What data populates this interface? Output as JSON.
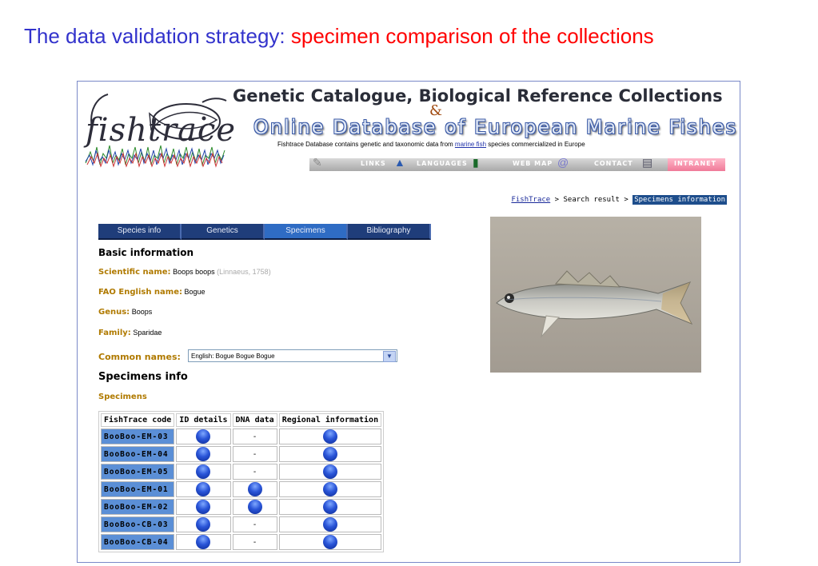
{
  "slide": {
    "title_part1": "The data validation strategy: ",
    "title_part2": "specimen comparison of the collections"
  },
  "header": {
    "logo_text": "fishtrace",
    "line1": "Genetic Catalogue, Biological Reference Collections",
    "ampersand": "&",
    "line2": "Online Database of European Marine Fishes",
    "desc_before": "Fishtrace Database contains genetic and taxonomic data from ",
    "desc_link": "marine fish",
    "desc_after": " species commercialized in Europe"
  },
  "nav": {
    "links": "LINKS",
    "languages": "LANGUAGES",
    "webmap": "WEB MAP",
    "contact": "CONTACT",
    "intranet": "INTRANET"
  },
  "breadcrumb": {
    "home": "FishTrace",
    "sep": " > ",
    "search": "Search result",
    "current": "Specimens information"
  },
  "tabs": [
    "Species info",
    "Genetics",
    "Specimens",
    "Bibliography"
  ],
  "basic": {
    "heading": "Basic information",
    "sci_label": "Scientific name:",
    "sci_value": "Boops boops",
    "sci_author": "(Linnaeus, 1758)",
    "fao_label": "FAO English name:",
    "fao_value": "Bogue",
    "genus_label": "Genus:",
    "genus_value": "Boops",
    "family_label": "Family:",
    "family_value": "Sparidae",
    "common_label": "Common names:",
    "common_value": "English:   Bogue  Bogue  Bogue"
  },
  "specimens": {
    "heading": "Specimens info",
    "subheading": "Specimens",
    "columns": [
      "FishTrace code",
      "ID details",
      "DNA data",
      "Regional information"
    ],
    "rows": [
      {
        "code": "BooBoo-EM-03",
        "dna": "-"
      },
      {
        "code": "BooBoo-EM-04",
        "dna": "-"
      },
      {
        "code": "BooBoo-EM-05",
        "dna": "-"
      },
      {
        "code": "BooBoo-EM-01",
        "dna": "dot"
      },
      {
        "code": "BooBoo-EM-02",
        "dna": "dot"
      },
      {
        "code": "BooBoo-CB-03",
        "dna": "-"
      },
      {
        "code": "BooBoo-CB-04",
        "dna": "-"
      }
    ]
  },
  "colors": {
    "title_blue": "#3333cc",
    "title_red": "#ff0000",
    "tab_bg": "#1f3d7a",
    "tab_active": "#2f6cc4",
    "label_gold": "#b07a00",
    "code_cell": "#5b8fd6"
  }
}
